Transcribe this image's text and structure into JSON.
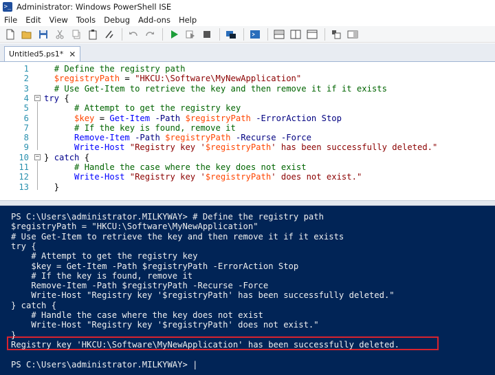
{
  "window": {
    "title": "Administrator: Windows PowerShell ISE",
    "app_icon_glyph": ">_"
  },
  "menu": [
    "File",
    "Edit",
    "View",
    "Tools",
    "Debug",
    "Add-ons",
    "Help"
  ],
  "toolbar": {
    "buttons": [
      "new-file",
      "open-file",
      "save",
      "cut",
      "copy",
      "paste",
      "clear-console",
      "undo",
      "redo",
      "run-script",
      "run-selection",
      "stop",
      "new-remote-tab",
      "start-powershell",
      "show-script-top",
      "show-script-right",
      "show-script-maximized",
      "show-command-addon",
      "show-command-window"
    ]
  },
  "tab": {
    "label": "Untitled5.ps1*",
    "close_glyph": "✕"
  },
  "editor": {
    "lines": [
      {
        "n": "1",
        "indent": "  ",
        "tokens": [
          {
            "c": "cm",
            "t": "# Define the registry path"
          }
        ]
      },
      {
        "n": "2",
        "indent": "  ",
        "tokens": [
          {
            "c": "vr",
            "t": "$registryPath"
          },
          {
            "c": "tx",
            "t": " = "
          },
          {
            "c": "st",
            "t": "\"HKCU:\\Software\\MyNewApplication\""
          }
        ]
      },
      {
        "n": "3",
        "indent": "  ",
        "tokens": [
          {
            "c": "cm",
            "t": "# Use Get-Item to retrieve the key and then remove it if it exists"
          }
        ]
      },
      {
        "n": "4",
        "indent": "",
        "fold": "−",
        "tokens": [
          {
            "c": "kw",
            "t": "try"
          },
          {
            "c": "tx",
            "t": " {"
          }
        ]
      },
      {
        "n": "5",
        "indent": "      ",
        "tokens": [
          {
            "c": "cm",
            "t": "# Attempt to get the registry key"
          }
        ]
      },
      {
        "n": "6",
        "indent": "      ",
        "tokens": [
          {
            "c": "vr",
            "t": "$key"
          },
          {
            "c": "tx",
            "t": " = "
          },
          {
            "c": "cmd",
            "t": "Get-Item"
          },
          {
            "c": "tx",
            "t": " "
          },
          {
            "c": "pm",
            "t": "-Path"
          },
          {
            "c": "tx",
            "t": " "
          },
          {
            "c": "vr",
            "t": "$registryPath"
          },
          {
            "c": "tx",
            "t": " "
          },
          {
            "c": "pm",
            "t": "-ErrorAction"
          },
          {
            "c": "tx",
            "t": " "
          },
          {
            "c": "pm",
            "t": "Stop"
          }
        ]
      },
      {
        "n": "7",
        "indent": "      ",
        "tokens": [
          {
            "c": "cm",
            "t": "# If the key is found, remove it"
          }
        ]
      },
      {
        "n": "8",
        "indent": "      ",
        "tokens": [
          {
            "c": "cmd",
            "t": "Remove-Item"
          },
          {
            "c": "tx",
            "t": " "
          },
          {
            "c": "pm",
            "t": "-Path"
          },
          {
            "c": "tx",
            "t": " "
          },
          {
            "c": "vr",
            "t": "$registryPath"
          },
          {
            "c": "tx",
            "t": " "
          },
          {
            "c": "pm",
            "t": "-Recurse"
          },
          {
            "c": "tx",
            "t": " "
          },
          {
            "c": "pm",
            "t": "-Force"
          }
        ]
      },
      {
        "n": "9",
        "indent": "      ",
        "tokens": [
          {
            "c": "cmd",
            "t": "Write-Host"
          },
          {
            "c": "tx",
            "t": " "
          },
          {
            "c": "st",
            "t": "\"Registry key '"
          },
          {
            "c": "vr",
            "t": "$registryPath"
          },
          {
            "c": "st",
            "t": "' has been successfully deleted.\""
          }
        ]
      },
      {
        "n": "10",
        "indent": "",
        "fold": "−",
        "tokens": [
          {
            "c": "tx",
            "t": "} "
          },
          {
            "c": "kw",
            "t": "catch"
          },
          {
            "c": "tx",
            "t": " {"
          }
        ]
      },
      {
        "n": "11",
        "indent": "      ",
        "tokens": [
          {
            "c": "cm",
            "t": "# Handle the case where the key does not exist"
          }
        ]
      },
      {
        "n": "12",
        "indent": "      ",
        "tokens": [
          {
            "c": "cmd",
            "t": "Write-Host"
          },
          {
            "c": "tx",
            "t": " "
          },
          {
            "c": "st",
            "t": "\"Registry key '"
          },
          {
            "c": "vr",
            "t": "$registryPath"
          },
          {
            "c": "st",
            "t": "' does not exist.\""
          }
        ]
      },
      {
        "n": "13",
        "indent": "  ",
        "tokens": [
          {
            "c": "tx",
            "t": "}"
          }
        ]
      }
    ]
  },
  "console": {
    "lines": [
      "PS C:\\Users\\administrator.MILKYWAY> # Define the registry path",
      "$registryPath = \"HKCU:\\Software\\MyNewApplication\"",
      "# Use Get-Item to retrieve the key and then remove it if it exists",
      "try {",
      "    # Attempt to get the registry key",
      "    $key = Get-Item -Path $registryPath -ErrorAction Stop",
      "    # If the key is found, remove it",
      "    Remove-Item -Path $registryPath -Recurse -Force",
      "    Write-Host \"Registry key '$registryPath' has been successfully deleted.\"",
      "} catch {",
      "    # Handle the case where the key does not exist",
      "    Write-Host \"Registry key '$registryPath' does not exist.\"",
      "}",
      "Registry key 'HKCU:\\Software\\MyNewApplication' has been successfully deleted.",
      "",
      "PS C:\\Users\\administrator.MILKYWAY> |"
    ],
    "highlight_color": "#d9232e",
    "background": "#012456"
  }
}
